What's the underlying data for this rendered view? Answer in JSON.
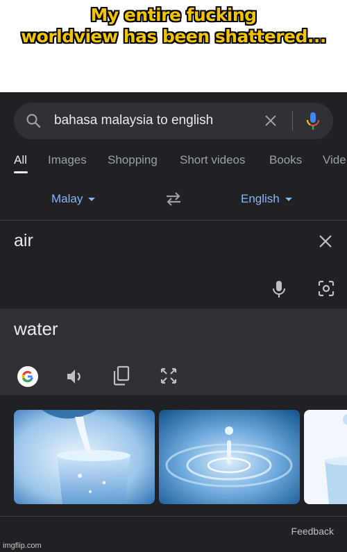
{
  "caption": {
    "line1": "My entire fucking",
    "line2": "worldview has been shattered..."
  },
  "search": {
    "query": "bahasa malaysia to english",
    "icons": [
      "search-icon",
      "clear-icon",
      "microphone-icon"
    ]
  },
  "tabs": [
    {
      "label": "All",
      "active": true
    },
    {
      "label": "Images"
    },
    {
      "label": "Shopping"
    },
    {
      "label": "Short videos"
    },
    {
      "label": "Books"
    },
    {
      "label": "Vide"
    }
  ],
  "translator": {
    "source_lang": "Malay",
    "target_lang": "English",
    "source_text": "air",
    "translated_text": "water",
    "icons": [
      "swap-icon",
      "close-icon",
      "microphone-icon",
      "camera-icon",
      "google-icon",
      "speaker-icon",
      "copy-icon",
      "fullscreen-icon"
    ]
  },
  "images": [
    {
      "name": "water-pouring-into-glass"
    },
    {
      "name": "water-droplet-splash"
    },
    {
      "name": "glass-of-water-partial"
    }
  ],
  "footer": {
    "feedback": "Feedback"
  },
  "watermark": "imgflip.com",
  "colors": {
    "caption": "#f3c400",
    "background": "#202124",
    "link": "#8ab4f8",
    "result_box": "#303134"
  }
}
